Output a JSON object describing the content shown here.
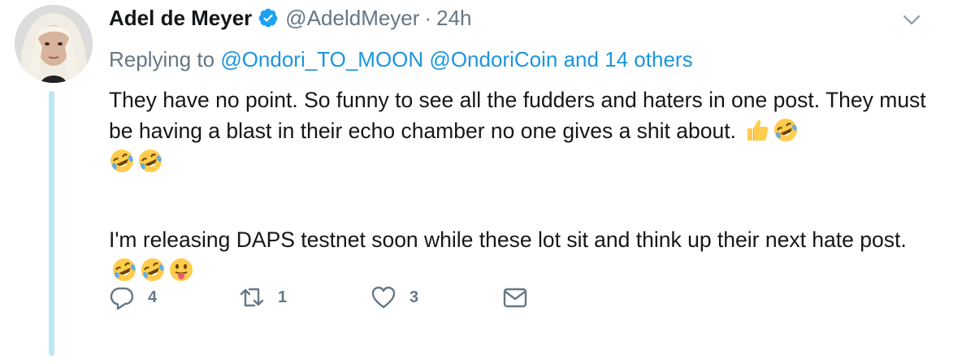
{
  "tweet": {
    "author_name": "Adel de Meyer",
    "handle": "@AdeldMeyer",
    "separator": "·",
    "time": "24h",
    "replying_prefix": "Replying to",
    "mentions": [
      "@Ondori_TO_MOON",
      "@OndoriCoin"
    ],
    "replying_suffix": "and 14 others",
    "paragraph1_a": "They have no point. So funny to see all the fudders and haters in one post. They must be having a blast in their echo chamber no one gives a shit about.",
    "paragraph2_a": "I'm releasing DAPS testnet soon while these lot sit and think up their next hate post.",
    "emojis": [
      "thumbs-up",
      "rolling-on-floor-laughing",
      "rolling-on-floor-laughing",
      "rolling-on-floor-laughing",
      "rolling-on-floor-laughing",
      "rolling-on-floor-laughing",
      "tongue-out"
    ]
  },
  "actions": {
    "reply_count": "4",
    "retweet_count": "1",
    "like_count": "3"
  },
  "colors": {
    "link": "#1b95e0",
    "muted": "#657786",
    "thread_line": "#bde6f8",
    "verified": "#1da1f2"
  }
}
